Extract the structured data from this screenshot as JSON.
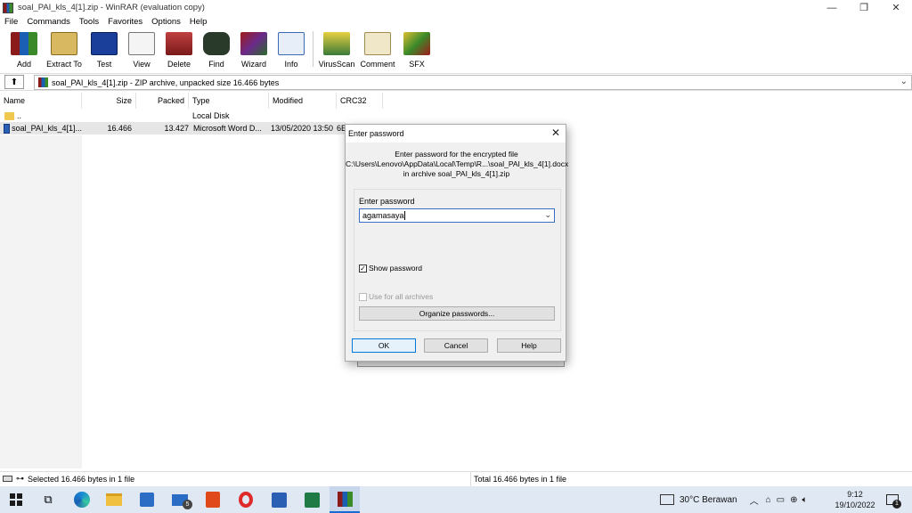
{
  "window": {
    "title": "soal_PAI_kls_4[1].zip - WinRAR (evaluation copy)",
    "minimize": "—",
    "restore": "❐",
    "close": "✕"
  },
  "menu": [
    "File",
    "Commands",
    "Tools",
    "Favorites",
    "Options",
    "Help"
  ],
  "toolbar": [
    {
      "label": "Add",
      "icon": "add-icon",
      "color": "#8b1a1a"
    },
    {
      "label": "Extract To",
      "icon": "extract-icon",
      "color": "#c8a040"
    },
    {
      "label": "Test",
      "icon": "test-icon",
      "color": "#1a3f9a"
    },
    {
      "label": "View",
      "icon": "view-icon",
      "color": "#777777"
    },
    {
      "label": "Delete",
      "icon": "delete-icon",
      "color": "#a03030"
    },
    {
      "label": "Find",
      "icon": "find-icon",
      "color": "#2a4a2a"
    },
    {
      "label": "Wizard",
      "icon": "wizard-icon",
      "color": "#6a2a8a"
    },
    {
      "label": "Info",
      "icon": "info-icon",
      "color": "#3a6ab4"
    },
    {
      "label": "VirusScan",
      "icon": "virusscan-icon",
      "color": "#c8a020"
    },
    {
      "label": "Comment",
      "icon": "comment-icon",
      "color": "#d8c080"
    },
    {
      "label": "SFX",
      "icon": "sfx-icon",
      "color": "#3a8a2a"
    }
  ],
  "address": {
    "text": "soal_PAI_kls_4[1].zip - ZIP archive, unpacked size 16.466 bytes"
  },
  "columns": [
    "Name",
    "Size",
    "Packed",
    "Type",
    "Modified",
    "CRC32"
  ],
  "files": [
    {
      "name": "..",
      "size": "",
      "packed": "",
      "type": "Local Disk",
      "modified": "",
      "crc": ""
    },
    {
      "name": "soal_PAI_kls_4[1]...",
      "size": "16.466",
      "packed": "13.427",
      "type": "Microsoft Word D...",
      "modified": "13/05/2020 13:50",
      "crc": "6E"
    }
  ],
  "status": {
    "left": "Selected 16.466 bytes in 1 file",
    "right": "Total 16.466 bytes in 1 file"
  },
  "dialog": {
    "title": "Enter password",
    "message_line1": "Enter password for the encrypted file",
    "message_line2": "C:\\Users\\Lenovo\\AppData\\Local\\Temp\\R...\\soal_PAI_kls_4[1].docx",
    "message_line3": "in archive soal_PAI_kls_4[1].zip",
    "field_label": "Enter password",
    "password_value": "agamasaya",
    "show_password_label": "Show password",
    "show_password_checked": true,
    "use_all_label": "Use for all archives",
    "organize_label": "Organize passwords...",
    "ok": "OK",
    "cancel": "Cancel",
    "help": "Help"
  },
  "taskbar": {
    "weather": "30°C  Berawan",
    "time": "9:12",
    "date": "19/10/2022",
    "notif_count": "1",
    "mail_badge": "5"
  }
}
